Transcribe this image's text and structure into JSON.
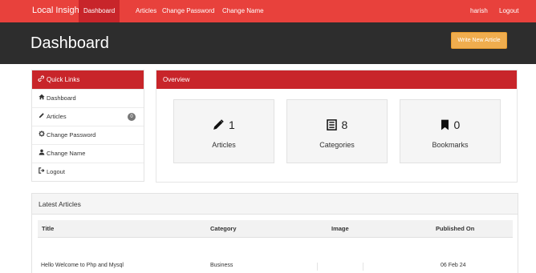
{
  "nav": {
    "brand": "Local Insight",
    "items": [
      {
        "label": "Dashboard",
        "active": true
      },
      {
        "label": "Articles",
        "active": false
      },
      {
        "label": "Change Password",
        "active": false
      },
      {
        "label": "Change Name",
        "active": false
      }
    ],
    "user": "harish",
    "logout": "Logout"
  },
  "header": {
    "title": "Dashboard",
    "write_button": "Write New Article"
  },
  "quick_links": {
    "title": "Quick Links",
    "items": [
      {
        "label": "Dashboard",
        "icon": "home-icon"
      },
      {
        "label": "Articles",
        "icon": "pencil-icon",
        "badge": "0"
      },
      {
        "label": "Change Password",
        "icon": "gear-icon"
      },
      {
        "label": "Change Name",
        "icon": "user-icon"
      },
      {
        "label": "Logout",
        "icon": "logout-icon"
      }
    ]
  },
  "overview": {
    "title": "Overview",
    "stats": [
      {
        "value": "1",
        "label": "Articles",
        "icon": "pencil-icon"
      },
      {
        "value": "8",
        "label": "Categories",
        "icon": "list-icon"
      },
      {
        "value": "0",
        "label": "Bookmarks",
        "icon": "bookmark-icon"
      }
    ]
  },
  "latest": {
    "title": "Latest Articles",
    "columns": [
      "Title",
      "Category",
      "Image",
      "Published On"
    ],
    "rows": [
      {
        "title": "Hello Welcome to Php and Mysql",
        "category": "Business",
        "published": "06 Feb 24"
      }
    ]
  },
  "colors": {
    "nav_red": "#e8413c",
    "panel_red": "#c8252a",
    "header_dark": "#2d2d2d",
    "button_orange": "#f0ad4e"
  }
}
